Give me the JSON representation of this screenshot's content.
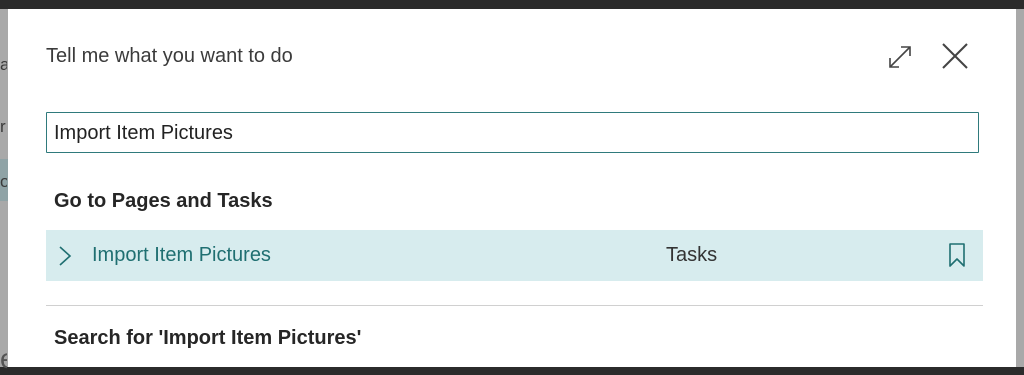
{
  "dialog": {
    "title": "Tell me what you want to do",
    "expand_icon": "expand-icon",
    "close_icon": "close-icon"
  },
  "search": {
    "value": "Import Item Pictures"
  },
  "sections": {
    "pages_and_tasks": {
      "heading": "Go to Pages and Tasks",
      "results": [
        {
          "label": "Import Item Pictures",
          "category": "Tasks",
          "icons": [
            "chevron-right-icon",
            "bookmark-icon"
          ]
        }
      ]
    },
    "search_for": {
      "heading": "Search for 'Import Item Pictures'"
    }
  },
  "colors": {
    "accent": "#1f6f71",
    "selected_row": "#d7ecee",
    "input_border": "#2f7a7c"
  }
}
